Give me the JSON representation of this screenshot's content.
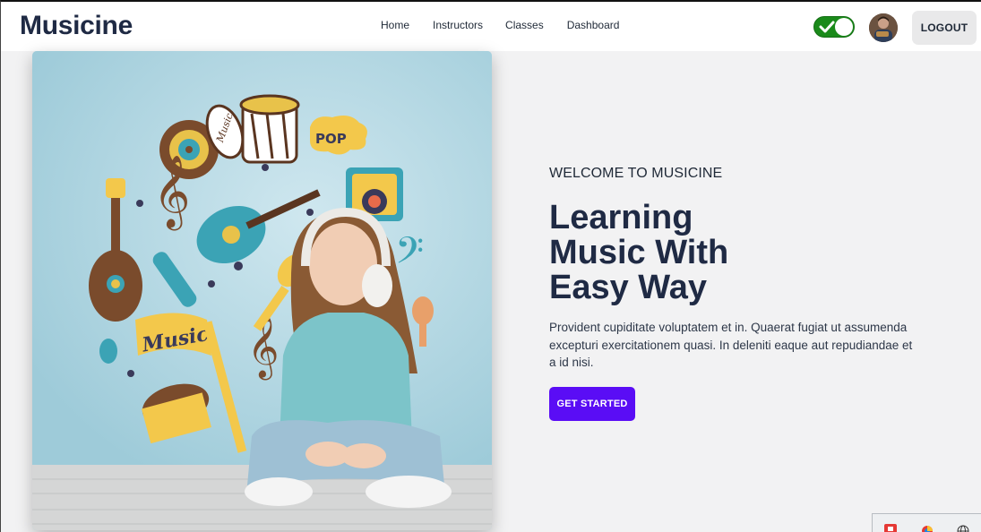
{
  "header": {
    "brand": "Musicine",
    "nav": [
      "Home",
      "Instructors",
      "Classes",
      "Dashboard"
    ],
    "theme_toggle_on": true,
    "logout_label": "LOGOUT",
    "colors": {
      "toggle": "#1a8a1a"
    }
  },
  "hero": {
    "eyebrow": "WELCOME TO MUSICINE",
    "title_lines": [
      "Learning",
      "Music With",
      "Easy Way"
    ],
    "description": "Provident cupiditate voluptatem et in. Quaerat fugiat ut assumenda excepturi exercitationem quasi. In deleniti eaque aut repudiandae et a id nisi.",
    "cta_label": "GET STARTED",
    "image_text": {
      "pop": "POP",
      "music_badge": "Music",
      "music_script": "Music"
    },
    "colors": {
      "cta": "#5a0df5",
      "heading": "#1f2a44"
    }
  },
  "tray": {
    "icons": [
      "app-icon-red",
      "chrome-icon",
      "globe-icon"
    ]
  }
}
